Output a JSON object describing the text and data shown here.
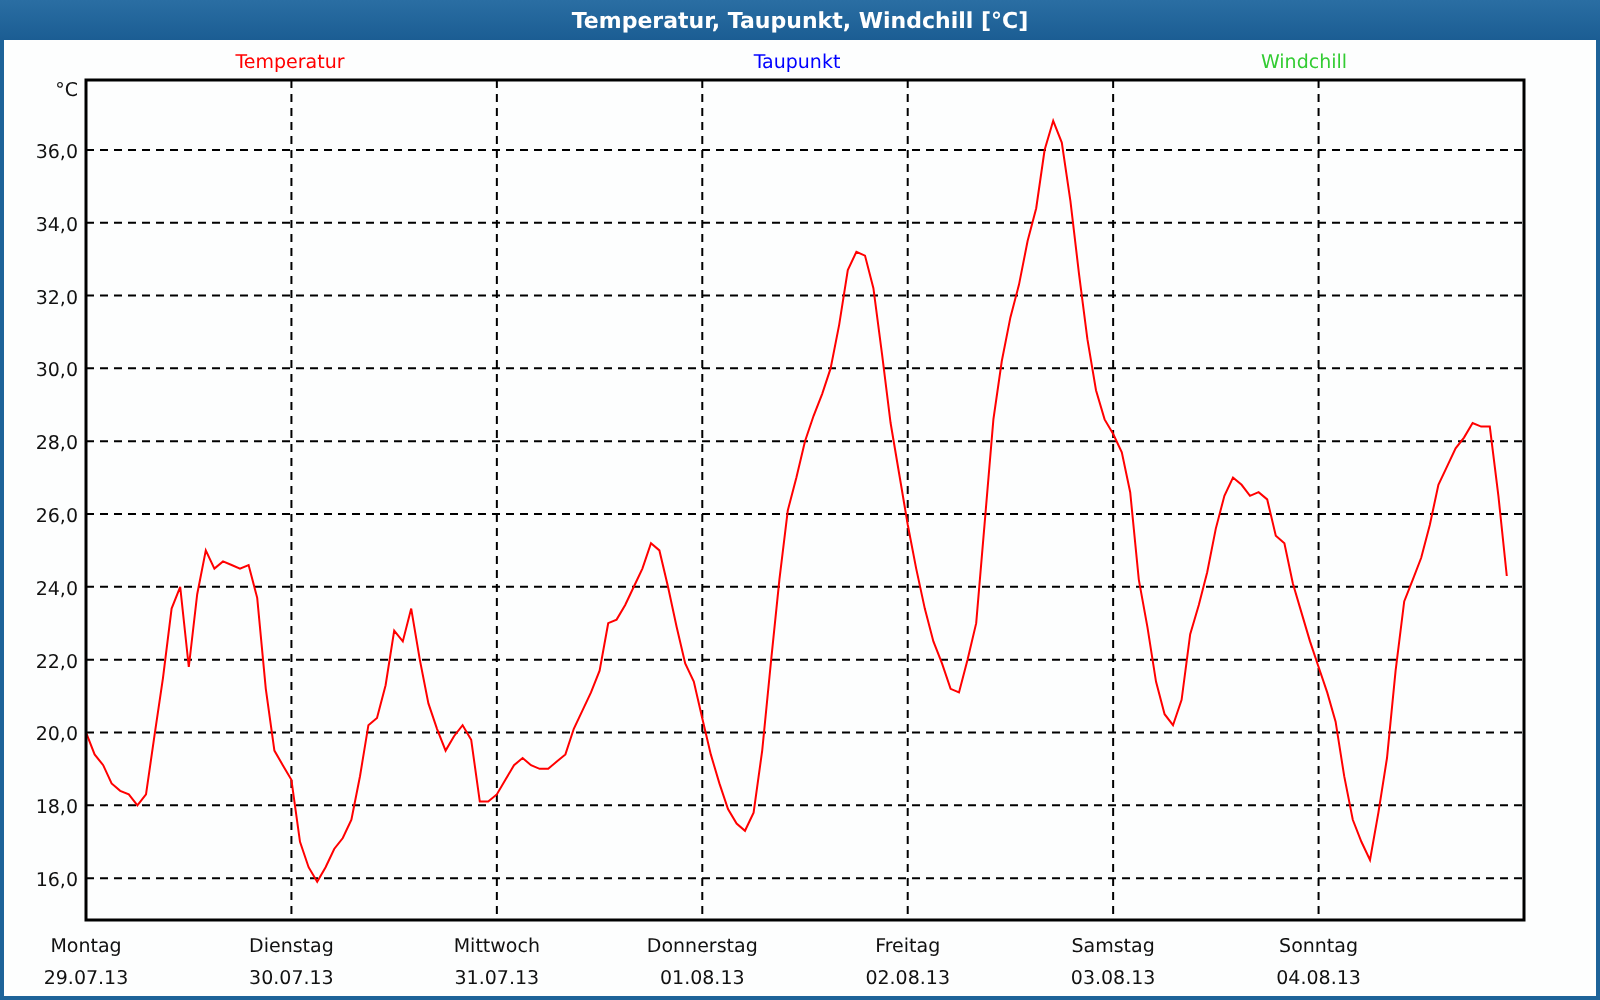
{
  "window": {
    "title": "Temperatur, Taupunkt, Windchill [°C]"
  },
  "legend": [
    {
      "name": "Taupunkt",
      "color": "#0000ff"
    },
    {
      "name": "Windchill",
      "color": "#33cc33"
    }
  ],
  "x_dates": [
    "29.07.13",
    "30.07.13",
    "31.07.13",
    "01.08.13",
    "02.08.13",
    "03.08.13",
    "04.08.13"
  ],
  "chart_data": {
    "type": "line",
    "ylabel": "°C",
    "grid": true,
    "ylim": [
      14.85,
      37.92
    ],
    "yticks": [
      {
        "value": 16,
        "label": "16,0"
      },
      {
        "value": 18,
        "label": "18,0"
      },
      {
        "value": 20,
        "label": "20,0"
      },
      {
        "value": 22,
        "label": "22,0"
      },
      {
        "value": 24,
        "label": "24,0"
      },
      {
        "value": 26,
        "label": "26,0"
      },
      {
        "value": 28,
        "label": "28,0"
      },
      {
        "value": 30,
        "label": "30,0"
      },
      {
        "value": 32,
        "label": "32,0"
      },
      {
        "value": 34,
        "label": "34,0"
      },
      {
        "value": 36,
        "label": "36,0"
      }
    ],
    "categories": [
      "Montag",
      null,
      null,
      null,
      null,
      null,
      null,
      null,
      null,
      null,
      null,
      null,
      null,
      null,
      null,
      null,
      null,
      null,
      null,
      null,
      null,
      null,
      null,
      null,
      "Dienstag",
      null,
      null,
      null,
      null,
      null,
      null,
      null,
      null,
      null,
      null,
      null,
      null,
      null,
      null,
      null,
      null,
      null,
      null,
      null,
      null,
      null,
      null,
      null,
      "Mittwoch",
      null,
      null,
      null,
      null,
      null,
      null,
      null,
      null,
      null,
      null,
      null,
      null,
      null,
      null,
      null,
      null,
      null,
      null,
      null,
      null,
      null,
      null,
      null,
      "Donnerstag",
      null,
      null,
      null,
      null,
      null,
      null,
      null,
      null,
      null,
      null,
      null,
      null,
      null,
      null,
      null,
      null,
      null,
      null,
      null,
      null,
      null,
      null,
      null,
      "Freitag",
      null,
      null,
      null,
      null,
      null,
      null,
      null,
      null,
      null,
      null,
      null,
      null,
      null,
      null,
      null,
      null,
      null,
      null,
      null,
      null,
      null,
      null,
      null,
      "Samstag",
      null,
      null,
      null,
      null,
      null,
      null,
      null,
      null,
      null,
      null,
      null,
      null,
      null,
      null,
      null,
      null,
      null,
      null,
      null,
      null,
      null,
      null,
      null,
      "Sonntag",
      null,
      null,
      null,
      null,
      null,
      null,
      null,
      null,
      null,
      null,
      null,
      null,
      null,
      null,
      null,
      null,
      null,
      null,
      null,
      null,
      null,
      null
    ],
    "series": [
      {
        "name": "Temperatur",
        "color": "#ff0000",
        "values": [
          20.0,
          19.4,
          19.1,
          18.6,
          18.4,
          18.3,
          18.0,
          18.3,
          19.9,
          21.5,
          23.4,
          24.0,
          21.8,
          23.8,
          25.0,
          24.5,
          24.7,
          24.6,
          24.5,
          24.6,
          23.7,
          21.2,
          19.5,
          19.1,
          18.7,
          17.0,
          16.3,
          15.9,
          16.3,
          16.8,
          17.1,
          17.6,
          18.8,
          20.2,
          20.4,
          21.3,
          22.8,
          22.5,
          23.4,
          22.0,
          20.8,
          20.1,
          19.5,
          19.9,
          20.2,
          19.8,
          18.1,
          18.1,
          18.3,
          18.7,
          19.1,
          19.3,
          19.1,
          19.0,
          19.0,
          19.2,
          19.4,
          20.1,
          20.6,
          21.1,
          21.7,
          23.0,
          23.1,
          23.5,
          24.0,
          24.5,
          25.2,
          25.0,
          24.0,
          22.9,
          21.9,
          21.4,
          20.4,
          19.4,
          18.6,
          17.9,
          17.5,
          17.3,
          17.8,
          19.5,
          21.9,
          24.2,
          26.1,
          27.0,
          28.0,
          28.7,
          29.3,
          30.0,
          31.2,
          32.7,
          33.2,
          33.1,
          32.2,
          30.4,
          28.5,
          27.1,
          25.7,
          24.5,
          23.4,
          22.5,
          21.9,
          21.2,
          21.1,
          22.0,
          23.0,
          25.8,
          28.6,
          30.2,
          31.4,
          32.3,
          33.5,
          34.4,
          36.0,
          36.8,
          36.2,
          34.6,
          32.6,
          30.8,
          29.4,
          28.6,
          28.2,
          27.7,
          26.6,
          24.2,
          22.9,
          21.4,
          20.5,
          20.2,
          20.9,
          22.7,
          23.5,
          24.4,
          25.6,
          26.5,
          27.0,
          26.8,
          26.5,
          26.6,
          26.4,
          25.4,
          25.2,
          24.1,
          23.3,
          22.5,
          21.8,
          21.1,
          20.3,
          18.8,
          17.6,
          17.0,
          16.5,
          17.8,
          19.3,
          21.7,
          23.6,
          24.2,
          24.8,
          25.7,
          26.8,
          27.3,
          27.8,
          28.1,
          28.5,
          28.4,
          28.4,
          26.5,
          24.3
        ]
      }
    ]
  }
}
